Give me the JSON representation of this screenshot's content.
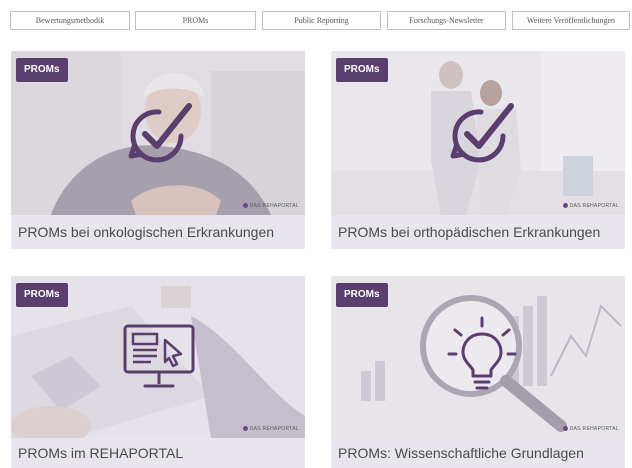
{
  "tabs": [
    {
      "label": "Bewertungsmethodik"
    },
    {
      "label": "PROMs"
    },
    {
      "label": "Public Reporting"
    },
    {
      "label": "Forschungs-Newsletter"
    },
    {
      "label": "Weitere Veröffentlichungen"
    }
  ],
  "cards": [
    {
      "badge": "PROMs",
      "title": "PROMs bei onkologischen Erkrankungen",
      "logo": "DAS REHAPORTAL",
      "icon": "check-cycle-icon"
    },
    {
      "badge": "PROMs",
      "title": "PROMs bei orthopädischen Erkrankungen",
      "logo": "DAS REHAPORTAL",
      "icon": "check-cycle-icon"
    },
    {
      "badge": "PROMs",
      "title": "PROMs im REHAPORTAL",
      "logo": "DAS REHAPORTAL",
      "icon": "monitor-cursor-icon"
    },
    {
      "badge": "PROMs",
      "title": "PROMs: Wissenschaftliche Grundlagen",
      "logo": "DAS REHAPORTAL",
      "icon": "lightbulb-icon"
    }
  ],
  "colors": {
    "badge_bg": "#5a3f6e",
    "caption_bg": "#e8e6ec",
    "icon_stroke": "#5a3f6e"
  }
}
